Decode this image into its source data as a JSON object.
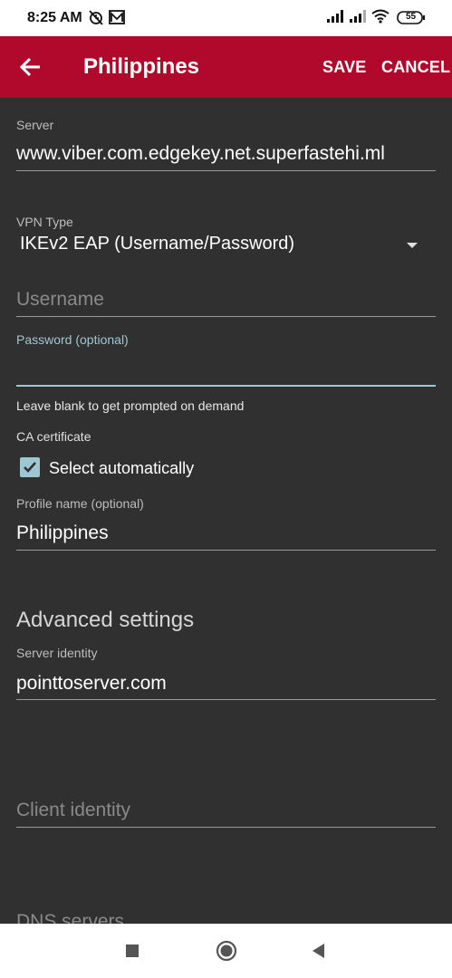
{
  "status_bar": {
    "time": "8:25 AM",
    "battery": "55",
    "icons": [
      "alarm-off-icon",
      "mail-icon",
      "signal-icon",
      "signal-icon",
      "wifi-icon",
      "battery-icon"
    ]
  },
  "app_bar": {
    "title": "Philippines",
    "save_label": "SAVE",
    "cancel_label": "CANCEL",
    "back_icon": "arrow-left-icon"
  },
  "form": {
    "server": {
      "label": "Server",
      "value": "www.viber.com.edgekey.net.superfastehi.ml"
    },
    "vpn_type": {
      "label": "VPN Type",
      "value": "IKEv2 EAP (Username/Password)"
    },
    "username": {
      "placeholder": "Username"
    },
    "password": {
      "label": "Password (optional)",
      "value": "",
      "helper": "Leave blank to get prompted on demand"
    },
    "ca_certificate": {
      "label": "CA certificate",
      "checkbox_label": "Select automatically",
      "checked": true
    },
    "profile_name": {
      "label": "Profile name (optional)",
      "value": "Philippines"
    },
    "advanced": {
      "heading": "Advanced settings",
      "server_identity": {
        "label": "Server identity",
        "value": "pointtoserver.com"
      },
      "client_identity": {
        "placeholder": "Client identity"
      },
      "dns_servers": {
        "placeholder": "DNS servers"
      }
    }
  },
  "colors": {
    "app_bar": "#b0092c",
    "accent": "#9ec7d4",
    "background": "#303030"
  }
}
